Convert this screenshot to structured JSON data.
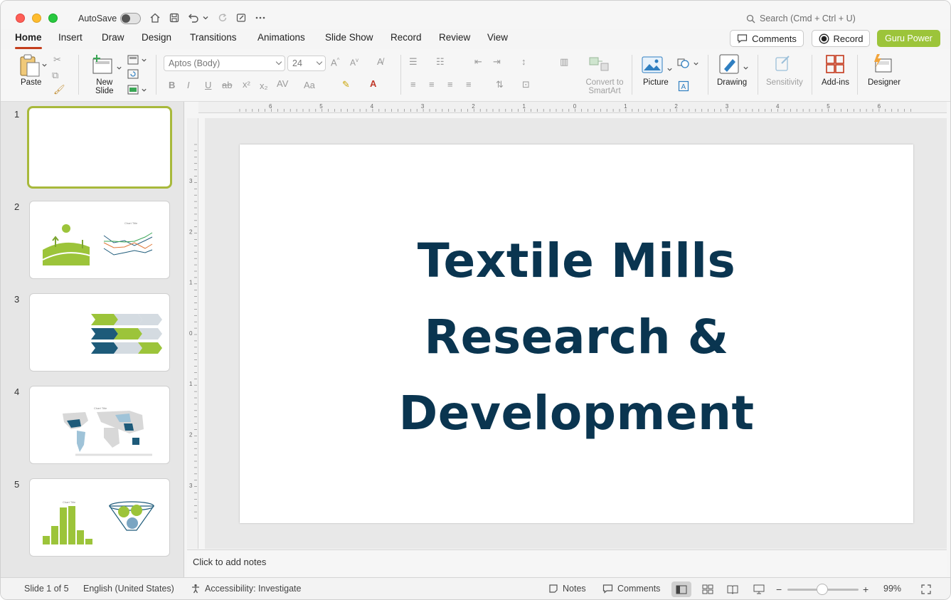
{
  "titlebar": {
    "autosave_label": "AutoSave",
    "search_placeholder": "Search (Cmd + Ctrl + U)"
  },
  "tabs": [
    "Home",
    "Insert",
    "Draw",
    "Design",
    "Transitions",
    "Animations",
    "Slide Show",
    "Record",
    "Review",
    "View"
  ],
  "active_tab": "Home",
  "actions": {
    "comments": "Comments",
    "record": "Record",
    "guru": "Guru Power",
    "guru_color": "#9cc43a"
  },
  "ribbon": {
    "paste": "Paste",
    "new_slide_line1": "New",
    "new_slide_line2": "Slide",
    "font_name": "Aptos (Body)",
    "font_size": "24",
    "convert_line1": "Convert to",
    "convert_line2": "SmartArt",
    "picture": "Picture",
    "drawing": "Drawing",
    "sensitivity": "Sensitivity",
    "addins": "Add-ins",
    "designer": "Designer"
  },
  "thumbnails": [
    {
      "num": "1",
      "selected": true
    },
    {
      "num": "2",
      "chart_title": "Chart Title"
    },
    {
      "num": "3"
    },
    {
      "num": "4",
      "chart_title": "Chart Title"
    },
    {
      "num": "5",
      "chart_title": "Chart Title"
    }
  ],
  "ruler": {
    "top_labels": [
      "6",
      "5",
      "4",
      "3",
      "2",
      "1",
      "0",
      "1",
      "2",
      "3",
      "4",
      "5",
      "6"
    ],
    "left_labels": [
      "3",
      "2",
      "1",
      "0",
      "1",
      "2",
      "3"
    ]
  },
  "slide": {
    "title_line1": "Textile Mills",
    "title_line2": "Research &",
    "title_line3": "Development",
    "title_color": "#0a3550"
  },
  "notes": {
    "placeholder": "Click to add notes"
  },
  "status": {
    "slide_info": "Slide 1 of 5",
    "language": "English (United States)",
    "accessibility": "Accessibility: Investigate",
    "notes": "Notes",
    "comments": "Comments",
    "zoom_minus": "−",
    "zoom_plus": "+",
    "zoom": "99%"
  },
  "icons": {
    "undo": "undo-icon",
    "redo": "redo-icon",
    "home": "home-icon",
    "save": "save-icon",
    "search": "search-icon"
  }
}
